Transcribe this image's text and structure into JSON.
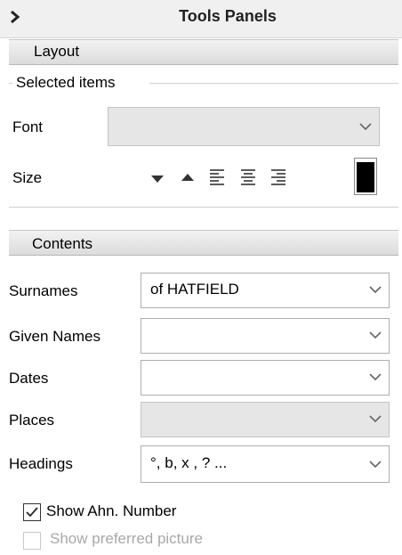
{
  "header": {
    "title": "Tools Panels",
    "expand_icon": "chevron-right-icon"
  },
  "layout": {
    "section_label": "Layout",
    "group_label": "Selected items",
    "font_label": "Font",
    "font_value": "",
    "size_label": "Size",
    "tools": [
      "triangle-down-icon",
      "triangle-up-icon",
      "align-left-icon",
      "align-center-icon",
      "align-right-icon",
      "color-swatch-icon"
    ],
    "swatch_color": "#000000"
  },
  "contents": {
    "section_label": "Contents",
    "fields": [
      {
        "label": "Surnames",
        "value": "of HATFIELD",
        "disabled": false
      },
      {
        "label": "Given Names",
        "value": "",
        "disabled": false
      },
      {
        "label": "Dates",
        "value": "",
        "disabled": false
      },
      {
        "label": "Places",
        "value": "",
        "disabled": true
      },
      {
        "label": "Headings",
        "value": "°, b, x , ? ...",
        "disabled": false
      }
    ],
    "show_ahn_label": "Show Ahn. Number",
    "show_ahn_checked": true,
    "show_picture_label": "Show preferred picture",
    "show_picture_checked": false
  }
}
